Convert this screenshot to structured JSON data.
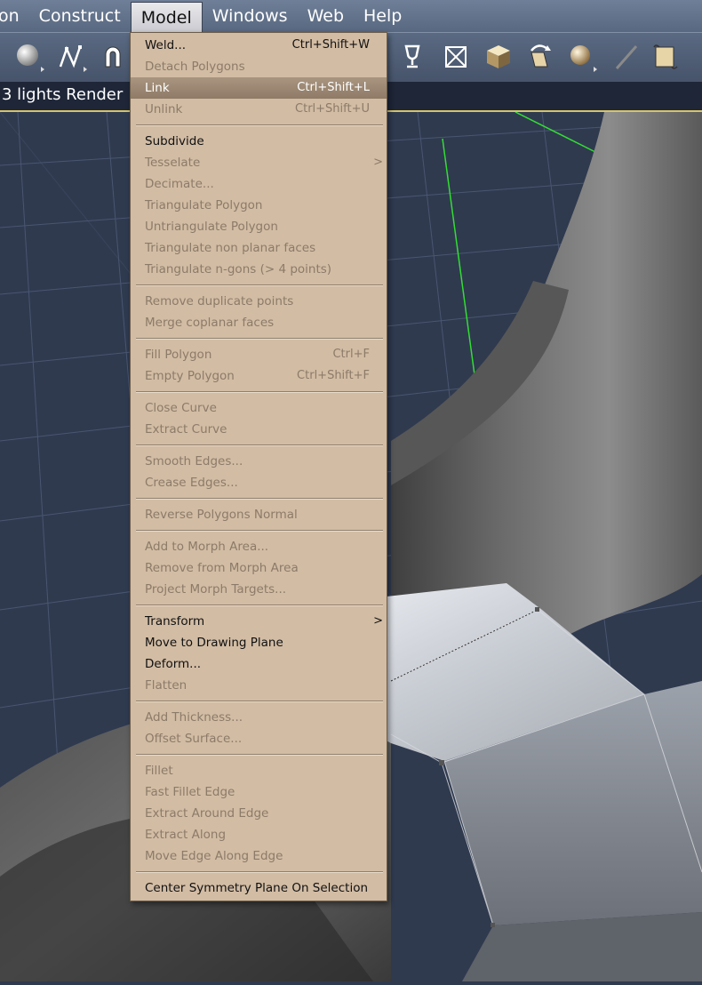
{
  "menubar": {
    "items": [
      {
        "label": "on"
      },
      {
        "label": "Construct"
      },
      {
        "label": "Model"
      },
      {
        "label": "Windows"
      },
      {
        "label": "Web"
      },
      {
        "label": "Help"
      }
    ],
    "active_index": 2
  },
  "status": {
    "text": "3 lights Render"
  },
  "toolbar": {
    "icons": [
      "sphere-tool-icon",
      "spline-tool-icon",
      "magnet-tool-icon",
      "goblet-tool-icon",
      "cube-wireframe-icon",
      "shaded-cube-icon",
      "rotate-box-icon",
      "sphere-material-icon",
      "pen-tool-icon",
      "scroll-tool-icon"
    ]
  },
  "menu": {
    "items": [
      {
        "label": "Weld...",
        "shortcut": "Ctrl+Shift+W",
        "enabled": true
      },
      {
        "label": "Detach Polygons",
        "shortcut": "",
        "enabled": false
      },
      {
        "label": "Link",
        "shortcut": "Ctrl+Shift+L",
        "enabled": true,
        "highlighted": true
      },
      {
        "label": "Unlink",
        "shortcut": "Ctrl+Shift+U",
        "enabled": false
      },
      {
        "separator": true
      },
      {
        "label": "Subdivide",
        "enabled": true
      },
      {
        "label": "Tesselate",
        "enabled": false,
        "submenu": ">"
      },
      {
        "label": "Decimate...",
        "enabled": false
      },
      {
        "label": "Triangulate Polygon",
        "enabled": false
      },
      {
        "label": "Untriangulate Polygon",
        "enabled": false
      },
      {
        "label": "Triangulate non planar faces",
        "enabled": false
      },
      {
        "label": "Triangulate n-gons (> 4 points)",
        "enabled": false
      },
      {
        "separator": true
      },
      {
        "label": "Remove duplicate points",
        "enabled": false
      },
      {
        "label": "Merge coplanar faces",
        "enabled": false
      },
      {
        "separator": true
      },
      {
        "label": "Fill Polygon",
        "shortcut": "Ctrl+F",
        "enabled": false
      },
      {
        "label": "Empty Polygon",
        "shortcut": "Ctrl+Shift+F",
        "enabled": false
      },
      {
        "separator": true
      },
      {
        "label": "Close Curve",
        "enabled": false
      },
      {
        "label": "Extract Curve",
        "enabled": false
      },
      {
        "separator": true
      },
      {
        "label": "Smooth Edges...",
        "enabled": false
      },
      {
        "label": "Crease Edges...",
        "enabled": false
      },
      {
        "separator": true
      },
      {
        "label": "Reverse Polygons Normal",
        "enabled": false
      },
      {
        "separator": true
      },
      {
        "label": "Add to Morph Area...",
        "enabled": false
      },
      {
        "label": "Remove from Morph Area",
        "enabled": false
      },
      {
        "label": "Project Morph Targets...",
        "enabled": false
      },
      {
        "separator": true
      },
      {
        "label": "Transform",
        "enabled": true,
        "submenu": ">"
      },
      {
        "label": "Move to Drawing Plane",
        "enabled": true
      },
      {
        "label": "Deform...",
        "enabled": true
      },
      {
        "label": "Flatten",
        "enabled": false
      },
      {
        "separator": true
      },
      {
        "label": "Add Thickness...",
        "enabled": false
      },
      {
        "label": "Offset Surface...",
        "enabled": false
      },
      {
        "separator": true
      },
      {
        "label": "Fillet",
        "enabled": false
      },
      {
        "label": "Fast Fillet Edge",
        "enabled": false
      },
      {
        "label": "Extract Around Edge",
        "enabled": false
      },
      {
        "label": "Extract Along",
        "enabled": false
      },
      {
        "label": "Move Edge Along Edge",
        "enabled": false
      },
      {
        "separator": true
      },
      {
        "label": "Center Symmetry Plane On Selection",
        "enabled": true
      }
    ]
  },
  "colors": {
    "menu_bg": "#d2bca4",
    "menu_highlight": "#9a8672",
    "viewport_bg": "#2f3a4f",
    "grid_line": "#4a5670",
    "accent_green": "#33dd33",
    "status_border": "#d6c46a"
  }
}
